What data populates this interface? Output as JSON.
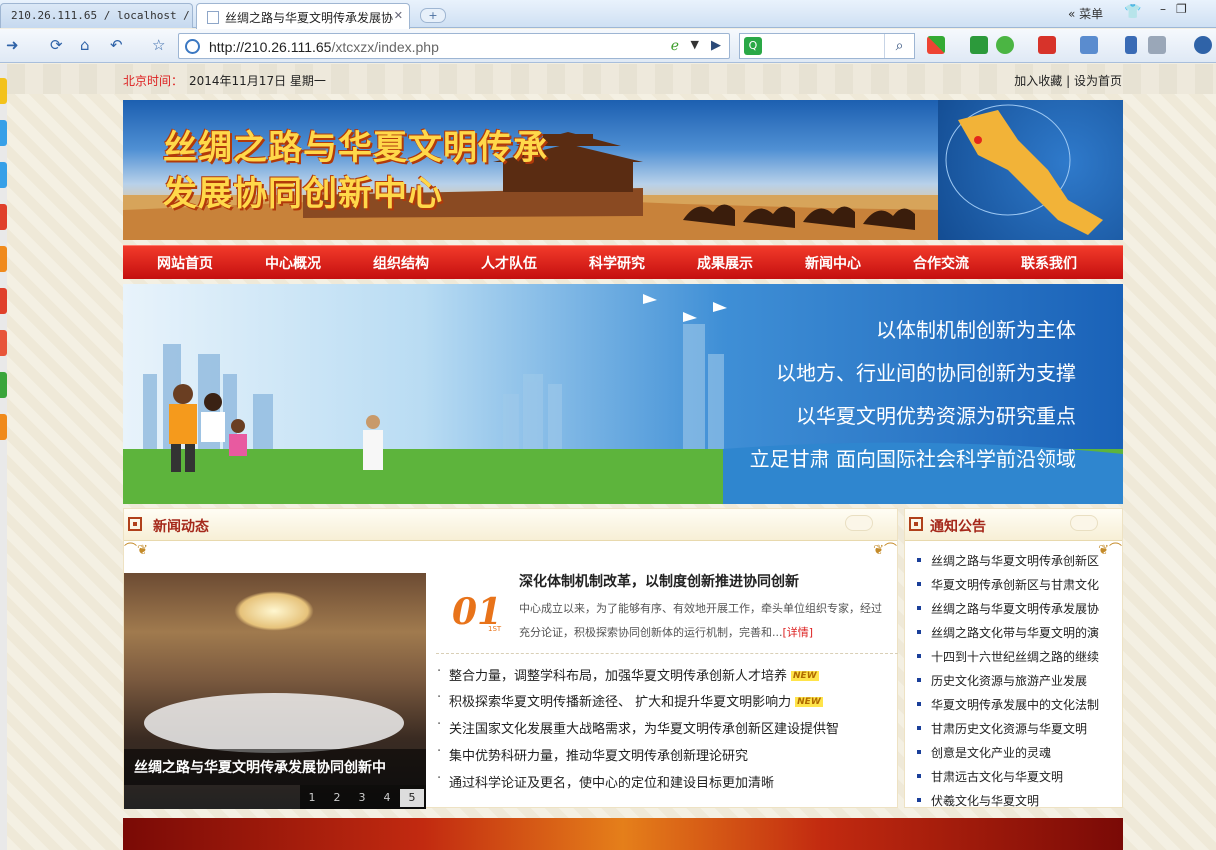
{
  "browser": {
    "tabs": [
      {
        "label": "210.26.111.65 / localhost / ×"
      },
      {
        "label": "丝绸之路与华夏文明传承发展协"
      }
    ],
    "menu_label": "菜单",
    "menu_chevron": "«",
    "address_host": "http://210.26.111.65",
    "address_path": "/xtcxzx/index.php",
    "search_placeholder": ""
  },
  "page": {
    "beijing_time_label": "北京时间：",
    "date": "2014年11月17日  星期一",
    "add_favorite": "加入收藏",
    "separator": "|",
    "set_homepage": "设为首页",
    "banner_title_line1": "丝绸之路与华夏文明传承",
    "banner_title_line2": "发展协同创新中心",
    "nav": [
      "网站首页",
      "中心概况",
      "组织结构",
      "人才队伍",
      "科学研究",
      "成果展示",
      "新闻中心",
      "合作交流",
      "联系我们"
    ],
    "hero_slogans": [
      "以体制机制创新为主体",
      "以地方、行业间的协同创新为支撑",
      "以华夏文明优势资源为研究重点",
      "立足甘肃 面向国际社会科学前沿领域"
    ],
    "news": {
      "heading": "新闻动态",
      "photo_caption": "丝绸之路与华夏文明传承发展协同创新中",
      "pager": [
        "1",
        "2",
        "3",
        "4",
        "5"
      ],
      "pager_active": "5",
      "badge_number": "01",
      "badge_suffix": "1ST",
      "lead_title": "深化体制机制改革，以制度创新推进协同创新",
      "lead_text": "中心成立以来，为了能够有序、有效地开展工作，牵头单位组织专家，经过充分论证，积极探索协同创新体的运行机制，完善和...",
      "detail_link": "[详情]",
      "new_badge": "NEW",
      "items": [
        {
          "text": "整合力量，调整学科布局，加强华夏文明传承创新人才培养",
          "new": true
        },
        {
          "text": "积极探索华夏文明传播新途径、 扩大和提升华夏文明影响力",
          "new": true
        },
        {
          "text": "关注国家文化发展重大战略需求，为华夏文明传承创新区建设提供智",
          "new": false
        },
        {
          "text": "集中优势科研力量，推动华夏文明传承创新理论研究",
          "new": false
        },
        {
          "text": "通过科学论证及更名，使中心的定位和建设目标更加清晰",
          "new": false
        }
      ]
    },
    "notice": {
      "heading": "通知公告",
      "items": [
        "丝绸之路与华夏文明传承创新区",
        "华夏文明传承创新区与甘肃文化",
        "丝绸之路与华夏文明传承发展协",
        "丝绸之路文化带与华夏文明的演",
        "十四到十六世纪丝绸之路的继续",
        "历史文化资源与旅游产业发展",
        "华夏文明传承发展中的文化法制",
        "甘肃历史文化资源与华夏文明",
        "创意是文化产业的灵魂",
        "甘肃远古文化与华夏文明",
        "伏羲文化与华夏文明"
      ]
    }
  },
  "colors": {
    "nav_red": "#d41a14",
    "heading_brown": "#a5281a",
    "time_label_red": "#dd2222",
    "notice_bullet": "#1a3f9a"
  }
}
